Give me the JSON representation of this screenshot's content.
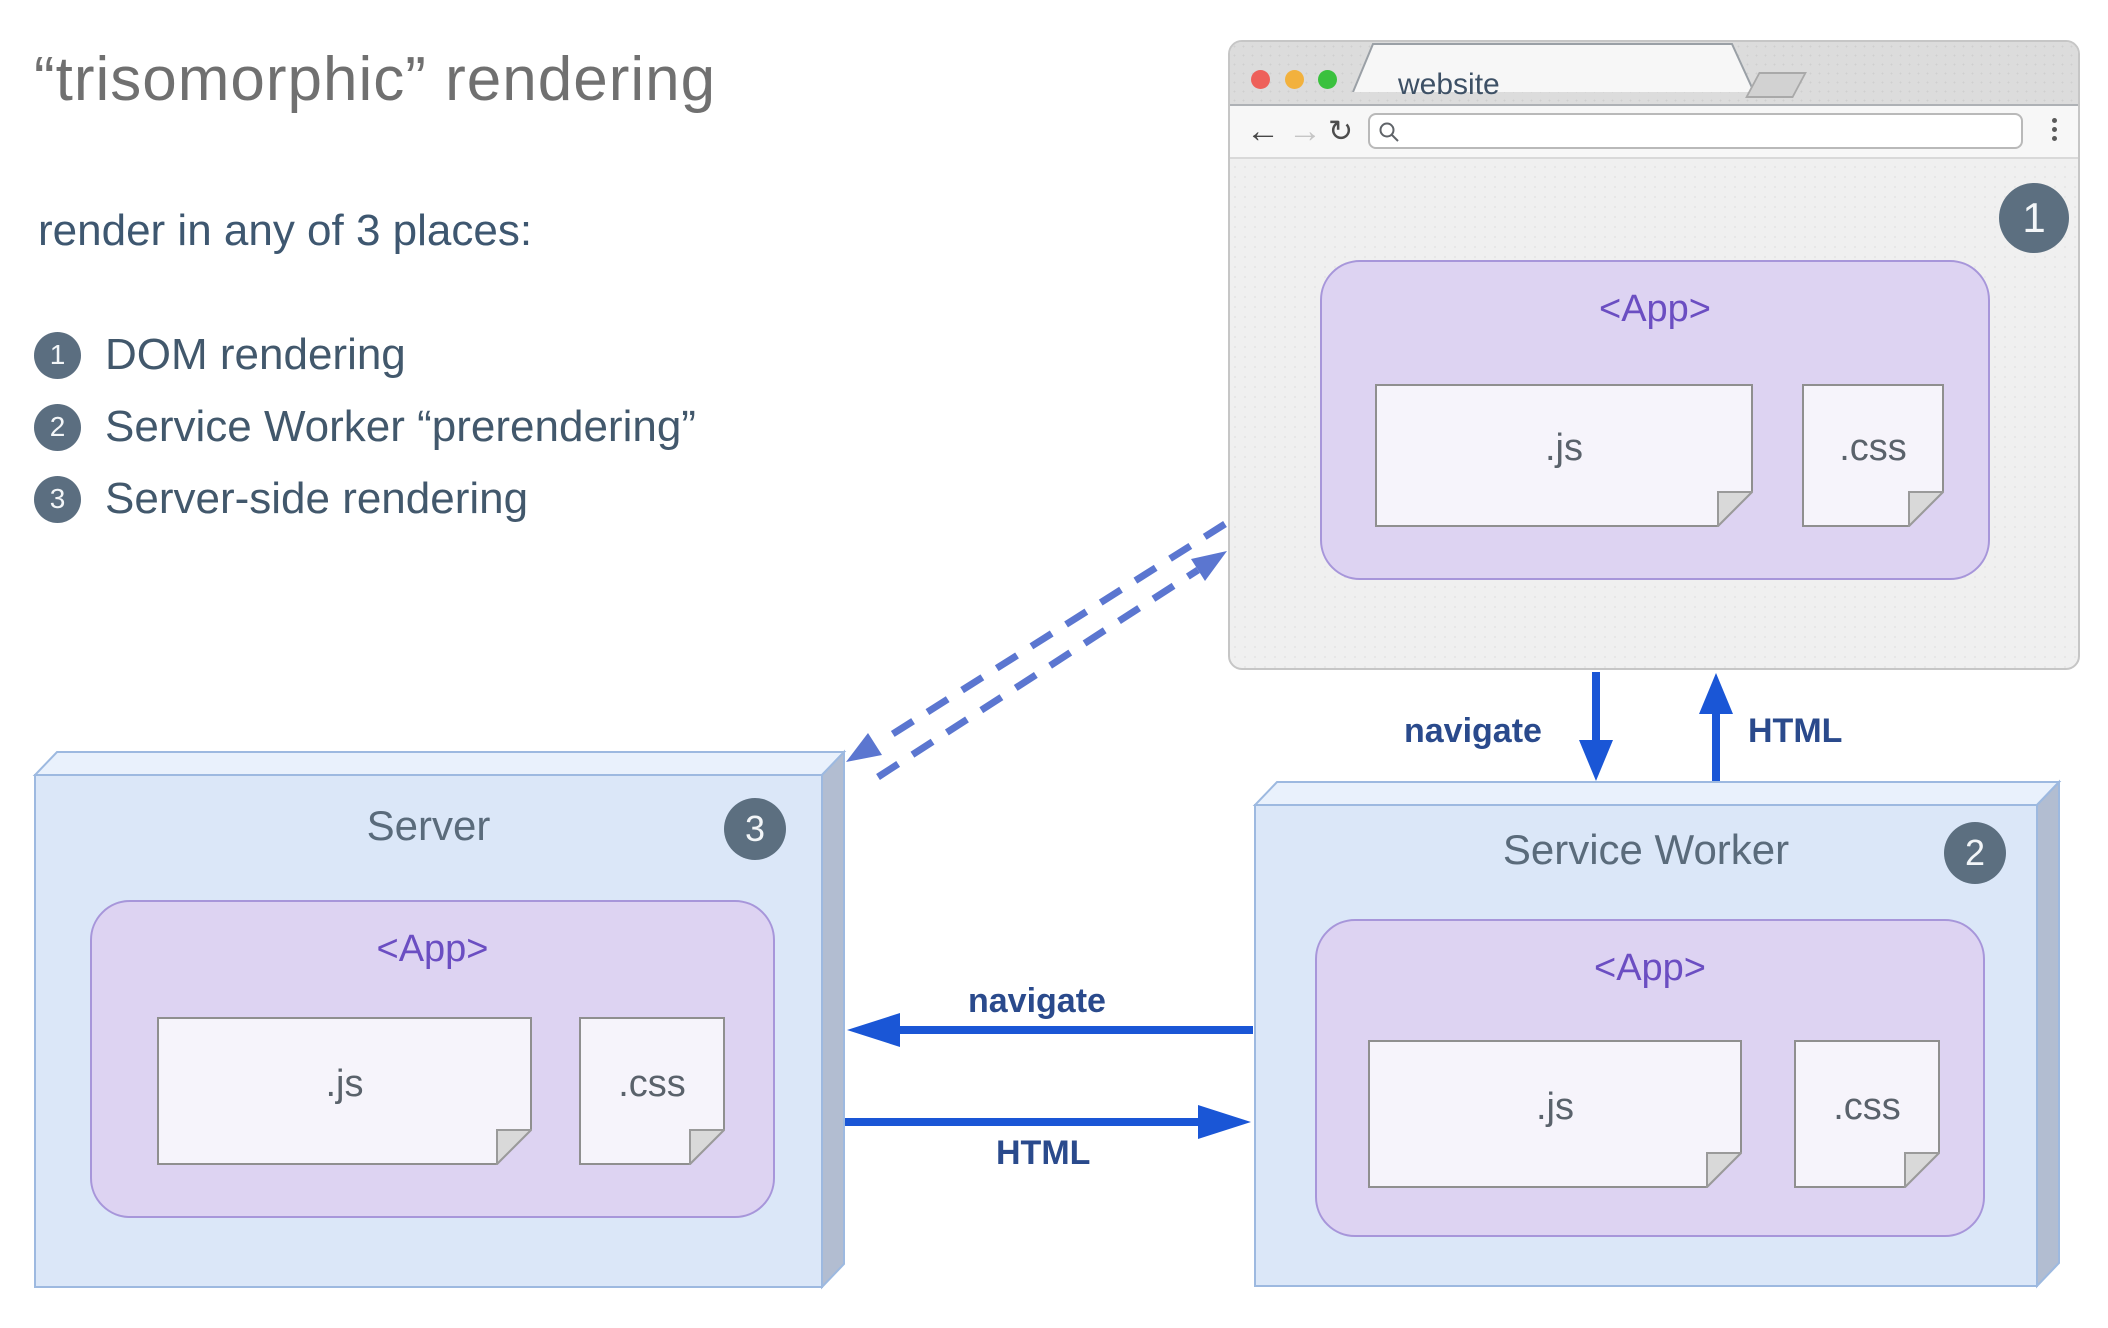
{
  "page": {
    "title": "“trisomorphic” rendering",
    "subtitle": "render in any of 3 places:"
  },
  "legend": {
    "items": [
      {
        "num": "1",
        "label": "DOM rendering"
      },
      {
        "num": "2",
        "label": "Service Worker “prerendering”"
      },
      {
        "num": "3",
        "label": "Server-side rendering"
      }
    ]
  },
  "browser": {
    "tab_title": "website",
    "address_value": "",
    "badge": "1",
    "app": {
      "label": "<App>",
      "files": [
        ".js",
        ".css"
      ]
    }
  },
  "server": {
    "title": "Server",
    "badge": "3",
    "app": {
      "label": "<App>",
      "files": [
        ".js",
        ".css"
      ]
    }
  },
  "service_worker": {
    "title": "Service Worker",
    "badge": "2",
    "app": {
      "label": "<App>",
      "files": [
        ".js",
        ".css"
      ]
    }
  },
  "arrows": {
    "browser_sw_down": "navigate",
    "browser_sw_up": "HTML",
    "sw_server_left": "navigate",
    "server_sw_right": "HTML"
  },
  "colors": {
    "arrow_blue": "#1a56d6",
    "arrow_label": "#2a4a8c",
    "dashed_line": "#5b76d0",
    "badge": "#5c6f80",
    "app_purple_text": "#6b4ec2",
    "app_fill": "#ddd3f2",
    "app_border": "#a796da",
    "box_fill": "#dbe7f8",
    "box_top_fill": "#e9f1fc",
    "box_side_fill": "#b2bdd1",
    "box_border": "#9db9e0",
    "file_fill": "#f6f4fb",
    "file_border": "#8f8f8f",
    "traffic_red": "#ee605a",
    "traffic_yellow": "#f2b13d",
    "traffic_green": "#3ac13e"
  }
}
